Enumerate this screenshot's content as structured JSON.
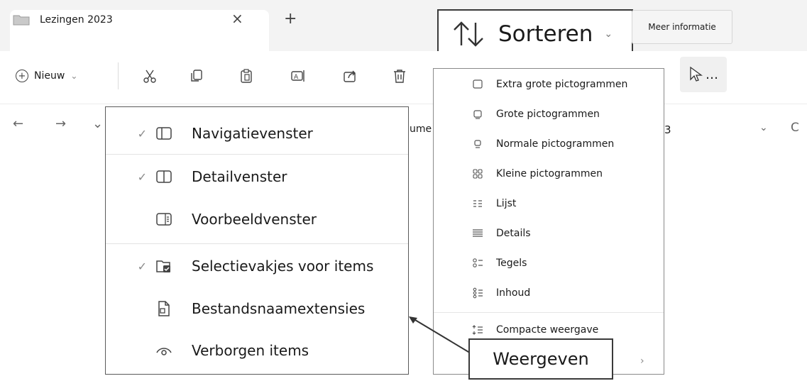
{
  "tab": {
    "title": "Lezingen 2023",
    "close": "×",
    "new_tab": "+"
  },
  "toolbar": {
    "new_label": "Nieuw",
    "new_chevron": "⌄",
    "more": "…"
  },
  "address": {
    "back": "←",
    "forward": "→",
    "recent": "⌄",
    "path_fragment": "ume",
    "search_fragment": "3",
    "dropdown": "⌄",
    "refresh": "C"
  },
  "callouts": {
    "sort_label": "Sorteren",
    "sort_chevron": "⌄",
    "meer_informatie": "Meer informatie",
    "weergeven": "Weergeven"
  },
  "show_menu": {
    "items": [
      {
        "label": "Navigatievenster",
        "checked": "✓",
        "icon": "navigation-pane-icon"
      },
      {
        "label": "Detailvenster",
        "checked": "✓",
        "icon": "details-pane-icon"
      },
      {
        "label": "Voorbeeldvenster",
        "checked": "",
        "icon": "preview-pane-icon"
      },
      {
        "label": "Selectievakjes voor items",
        "checked": "✓",
        "icon": "checkbox-items-icon"
      },
      {
        "label": "Bestandsnaamextensies",
        "checked": "",
        "icon": "file-extension-icon"
      },
      {
        "label": "Verborgen items",
        "checked": "",
        "icon": "eye-icon"
      }
    ]
  },
  "view_menu": {
    "items": [
      {
        "label": "Extra grote pictogrammen",
        "icon": "extra-large-icons-icon"
      },
      {
        "label": "Grote pictogrammen",
        "icon": "large-icons-icon"
      },
      {
        "label": "Normale pictogrammen",
        "icon": "medium-icons-icon"
      },
      {
        "label": "Kleine pictogrammen",
        "icon": "small-icons-icon"
      },
      {
        "label": "Lijst",
        "icon": "list-icon"
      },
      {
        "label": "Details",
        "icon": "details-icon"
      },
      {
        "label": "Tegels",
        "icon": "tiles-icon"
      },
      {
        "label": "Inhoud",
        "icon": "content-icon"
      },
      {
        "label": "Compacte weergave",
        "icon": "compact-view-icon"
      }
    ],
    "submenu_chevron": "›"
  }
}
